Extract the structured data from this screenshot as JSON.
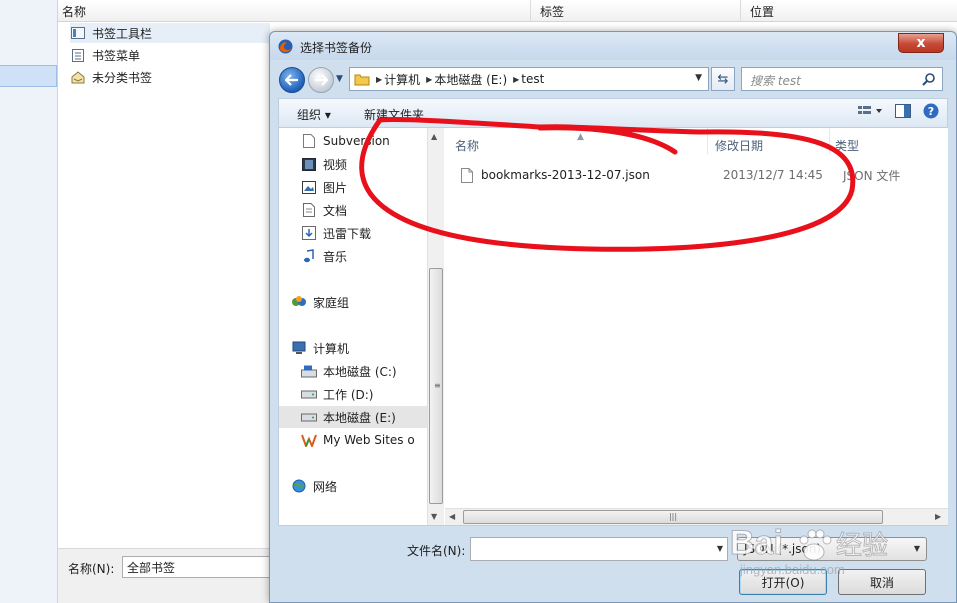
{
  "background": {
    "columns": [
      "名称",
      "标签",
      "位置"
    ],
    "tree": [
      "书签工具栏",
      "书签菜单",
      "未分类书签"
    ],
    "name_label": "名称(N):",
    "name_value": "全部书签"
  },
  "dialog": {
    "title": "选择书签备份",
    "close": "x",
    "breadcrumb": [
      "计算机",
      "本地磁盘 (E:)",
      "test"
    ],
    "search_placeholder": "搜索 test",
    "toolbar": {
      "organize": "组织 ▾",
      "new_folder": "新建文件夹"
    },
    "nav_items": [
      "Subversion",
      "视频",
      "图片",
      "文档",
      "迅雷下载",
      "音乐",
      "家庭组",
      "计算机",
      "本地磁盘 (C:)",
      "工作 (D:)",
      "本地磁盘 (E:)",
      "My Web Sites o",
      "网络"
    ],
    "columns": {
      "name": "名称",
      "date": "修改日期",
      "type": "类型"
    },
    "files": [
      {
        "name": "bookmarks-2013-12-07.json",
        "date": "2013/12/7 14:45",
        "type": "JSON 文件"
      }
    ],
    "filename_label": "文件名(N):",
    "filename_value": "",
    "filetype_value": "JSON (*.json)",
    "open_button": "打开(O)",
    "cancel_button": "取消"
  },
  "watermark": {
    "text": "Bai",
    "text2": "经验",
    "url": "jingyan.baidu.com"
  },
  "colors": {
    "annotation": "#e8101a",
    "accent": "#1f5fb8"
  }
}
